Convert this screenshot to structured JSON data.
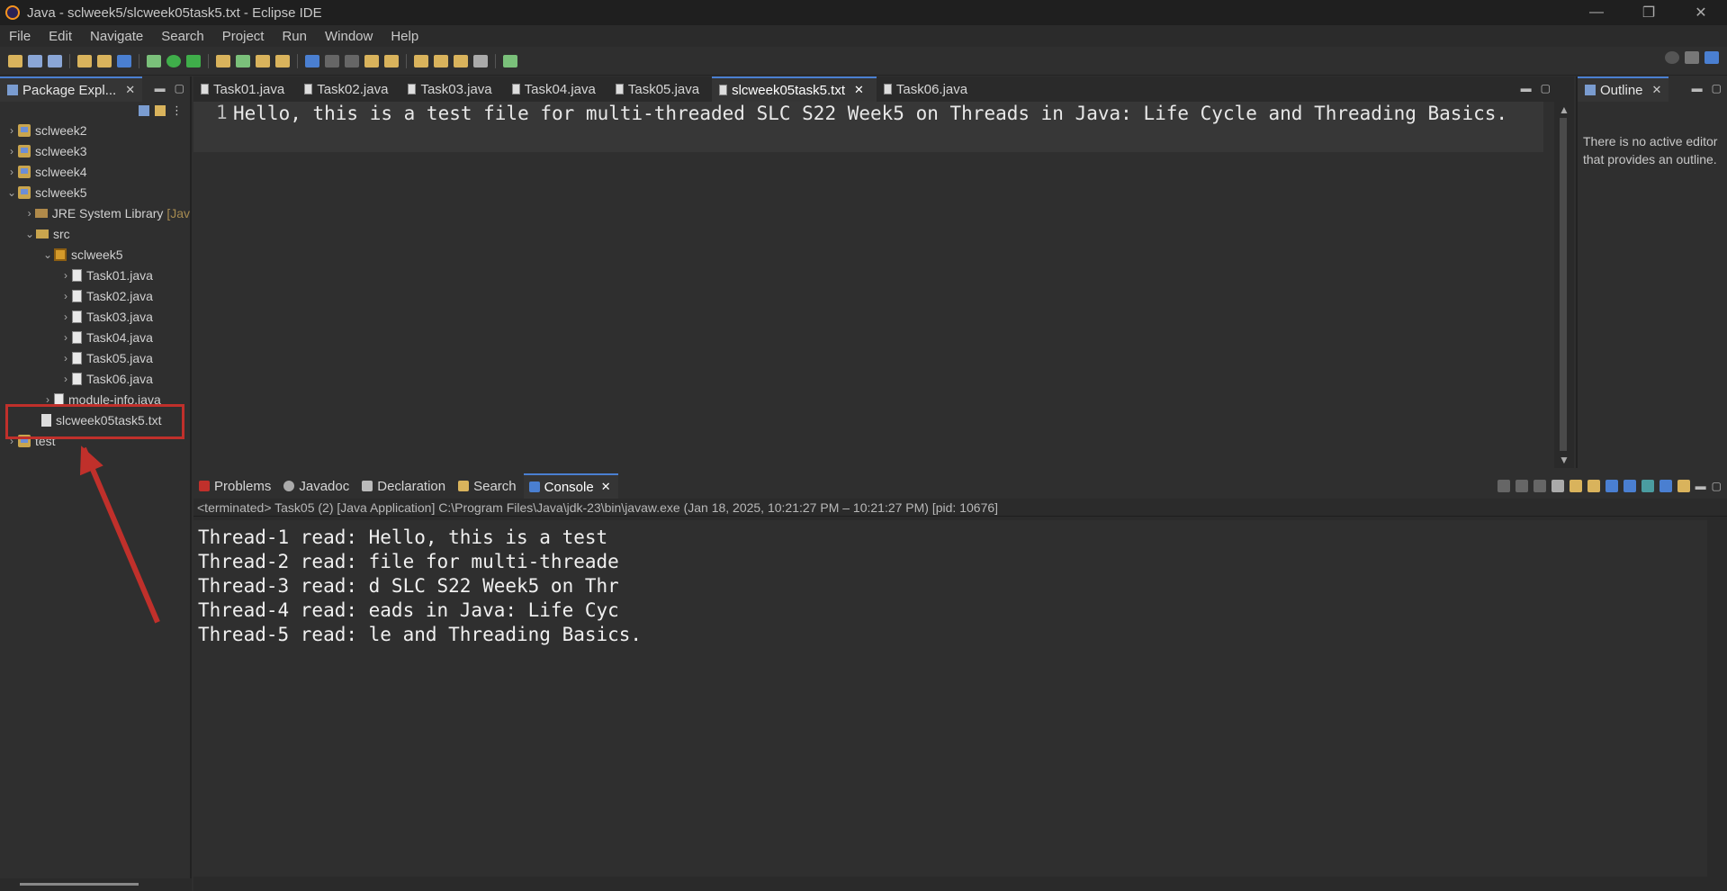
{
  "window": {
    "title": "Java - sclweek5/slcweek05task5.txt - Eclipse IDE",
    "controls": [
      "—",
      "❐",
      "✕"
    ]
  },
  "menu": [
    "File",
    "Edit",
    "Navigate",
    "Search",
    "Project",
    "Run",
    "Window",
    "Help"
  ],
  "package_explorer": {
    "tab_label": "Package Expl...",
    "items": [
      {
        "label": "sclweek2"
      },
      {
        "label": "sclweek3"
      },
      {
        "label": "sclweek4"
      },
      {
        "label": "sclweek5"
      },
      {
        "label": "JRE System Library",
        "suffix": "[Jav"
      },
      {
        "label": "src"
      },
      {
        "label": "sclweek5"
      },
      {
        "label": "Task01.java"
      },
      {
        "label": "Task02.java"
      },
      {
        "label": "Task03.java"
      },
      {
        "label": "Task04.java"
      },
      {
        "label": "Task05.java"
      },
      {
        "label": "Task06.java"
      },
      {
        "label": "module-info.java"
      },
      {
        "label": "slcweek05task5.txt"
      },
      {
        "label": "test"
      }
    ]
  },
  "editor": {
    "tabs": [
      "Task01.java",
      "Task02.java",
      "Task03.java",
      "Task04.java",
      "Task05.java",
      "slcweek05task5.txt",
      "Task06.java"
    ],
    "active_tab": "slcweek05task5.txt",
    "line_number": "1",
    "content": "Hello, this is a test file for multi-threaded SLC S22 Week5 on Threads in Java: Life Cycle and Threading Basics."
  },
  "outline": {
    "tab_label": "Outline",
    "message": "There is no active editor that provides an outline."
  },
  "console": {
    "tabs": [
      "Problems",
      "Javadoc",
      "Declaration",
      "Search",
      "Console"
    ],
    "active_tab": "Console",
    "status": "<terminated> Task05 (2) [Java Application] C:\\Program Files\\Java\\jdk-23\\bin\\javaw.exe  (Jan 18, 2025, 10:21:27 PM – 10:21:27 PM) [pid: 10676]",
    "lines": [
      "Thread-1 read: Hello, this is a test",
      "Thread-2 read: file for multi-threade",
      "Thread-3 read: d SLC S22 Week5 on Thr",
      "Thread-4 read: eads in Java: Life Cyc",
      "Thread-5 read: le and Threading Basics."
    ]
  },
  "colors": {
    "accent": "#4a7fd1",
    "highlight": "#c0302b"
  }
}
